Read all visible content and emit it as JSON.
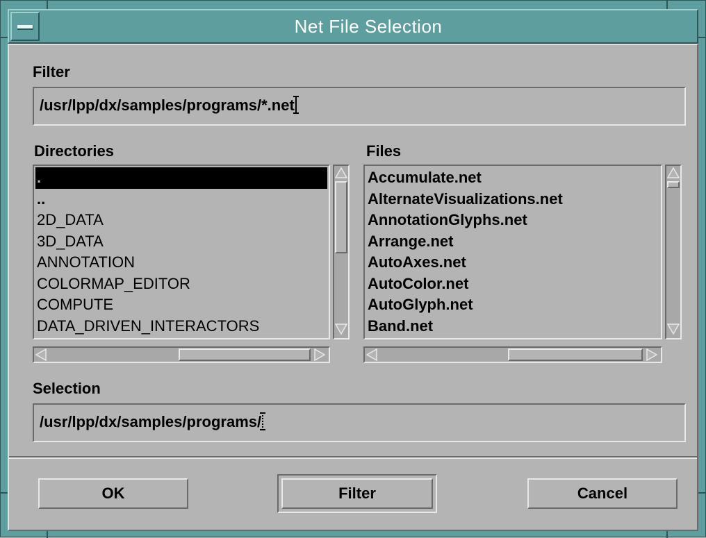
{
  "window": {
    "title": "Net File Selection"
  },
  "filter": {
    "label": "Filter",
    "value": "/usr/lpp/dx/samples/programs/*.net"
  },
  "directories": {
    "label": "Directories",
    "items": [
      ".",
      "..",
      "2D_DATA",
      "3D_DATA",
      "ANNOTATION",
      "COLORMAP_EDITOR",
      "COMPUTE",
      "DATA_DRIVEN_INTERACTORS"
    ],
    "selected_index": 0
  },
  "files": {
    "label": "Files",
    "items": [
      "Accumulate.net",
      "AlternateVisualizations.net",
      "AnnotationGlyphs.net",
      "Arrange.net",
      "AutoAxes.net",
      "AutoColor.net",
      "AutoGlyph.net",
      "Band.net"
    ]
  },
  "selection": {
    "label": "Selection",
    "value": "/usr/lpp/dx/samples/programs/"
  },
  "buttons": {
    "ok": "OK",
    "filter": "Filter",
    "cancel": "Cancel"
  },
  "colors": {
    "title_bar": "#5f9e9e",
    "dialog_background": "#b4b4b4",
    "selection_highlight": "#000000"
  }
}
